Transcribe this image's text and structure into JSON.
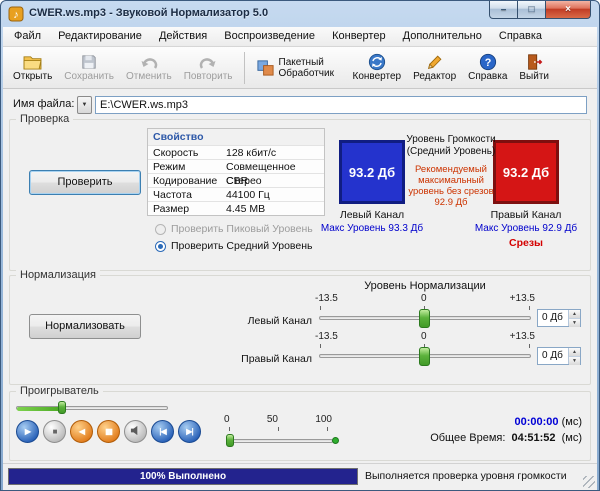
{
  "window": {
    "title": "CWER.ws.mp3 - Звуковой Нормализатор 5.0",
    "controls": {
      "minimize": "–",
      "maximize": "□",
      "close": "×"
    }
  },
  "menu": {
    "items": [
      "Файл",
      "Редактирование",
      "Действия",
      "Воспроизведение",
      "Конвертер",
      "Дополнительно",
      "Справка"
    ]
  },
  "toolbar": {
    "open": "Открыть",
    "save": "Сохранить",
    "undo": "Отменить",
    "redo": "Повторить",
    "batch": "Пакетный Обработчик",
    "converter": "Конвертер",
    "editor": "Редактор",
    "help": "Справка",
    "exit": "Выйти"
  },
  "file": {
    "label": "Имя файла:",
    "value": "E:\\CWER.ws.mp3"
  },
  "test": {
    "group_label": "Проверка",
    "button": "Проверить",
    "table": {
      "header": "Свойство",
      "rows": [
        {
          "name": "Скорость",
          "value": "128 кбит/с"
        },
        {
          "name": "Режим",
          "value": "Совмещенное Стерео"
        },
        {
          "name": "Кодирование",
          "value": "CBR"
        },
        {
          "name": "Частота",
          "value": "44100 Гц"
        },
        {
          "name": "Размер",
          "value": "4.45 MB"
        }
      ]
    },
    "radio_peak": "Проверить Пиковый Уровень",
    "radio_avg": "Проверить Средний Уровень",
    "left_level": "93.2 Дб",
    "right_level": "93.2 Дб",
    "heading": "Уровень Громкости (Средний Уровень)",
    "recommendation": "Рекомендуемый максимальный уровень без срезов 92.9 Дб",
    "left_channel": "Левый Канал",
    "left_max": "Макс Уровень 93.3 Дб",
    "right_channel": "Правый Канал",
    "right_max": "Макс Уровень 92.9 Дб",
    "clipping": "Срезы"
  },
  "normalize": {
    "group_label": "Нормализация",
    "button": "Нормализовать",
    "title": "Уровень Нормализации",
    "scale": {
      "min": "-13.5",
      "mid": "0",
      "max": "+13.5"
    },
    "left_label": "Левый Канал",
    "right_label": "Правый Канал",
    "left_value": "0 Дб",
    "right_value": "0 Дб"
  },
  "player": {
    "group_label": "Проигрыватель",
    "scale": {
      "p0": "0",
      "p50": "50",
      "p100": "100"
    },
    "elapsed": "00:00:00",
    "elapsed_units": "(мс)",
    "total_label": "Общее Время:",
    "total": "04:51:52",
    "total_units": "(мс)"
  },
  "status": {
    "progress": "100% Выполнено",
    "text": "Выполняется проверка уровня громкости"
  },
  "icons": {
    "dropdown": "▼",
    "spin_up": "▲",
    "spin_down": "▼",
    "play": "▶",
    "stop": "■",
    "rewind": "◀",
    "pause": "▮▮",
    "prev": "|◀",
    "next": "▶|"
  },
  "colors": {
    "left_box": "#2433cd",
    "right_box": "#d51515",
    "accent_blue": "#0000cc",
    "alert_red": "#cc3300",
    "progress_fill": "#23238e",
    "slider_handle": "#5cb23c"
  }
}
